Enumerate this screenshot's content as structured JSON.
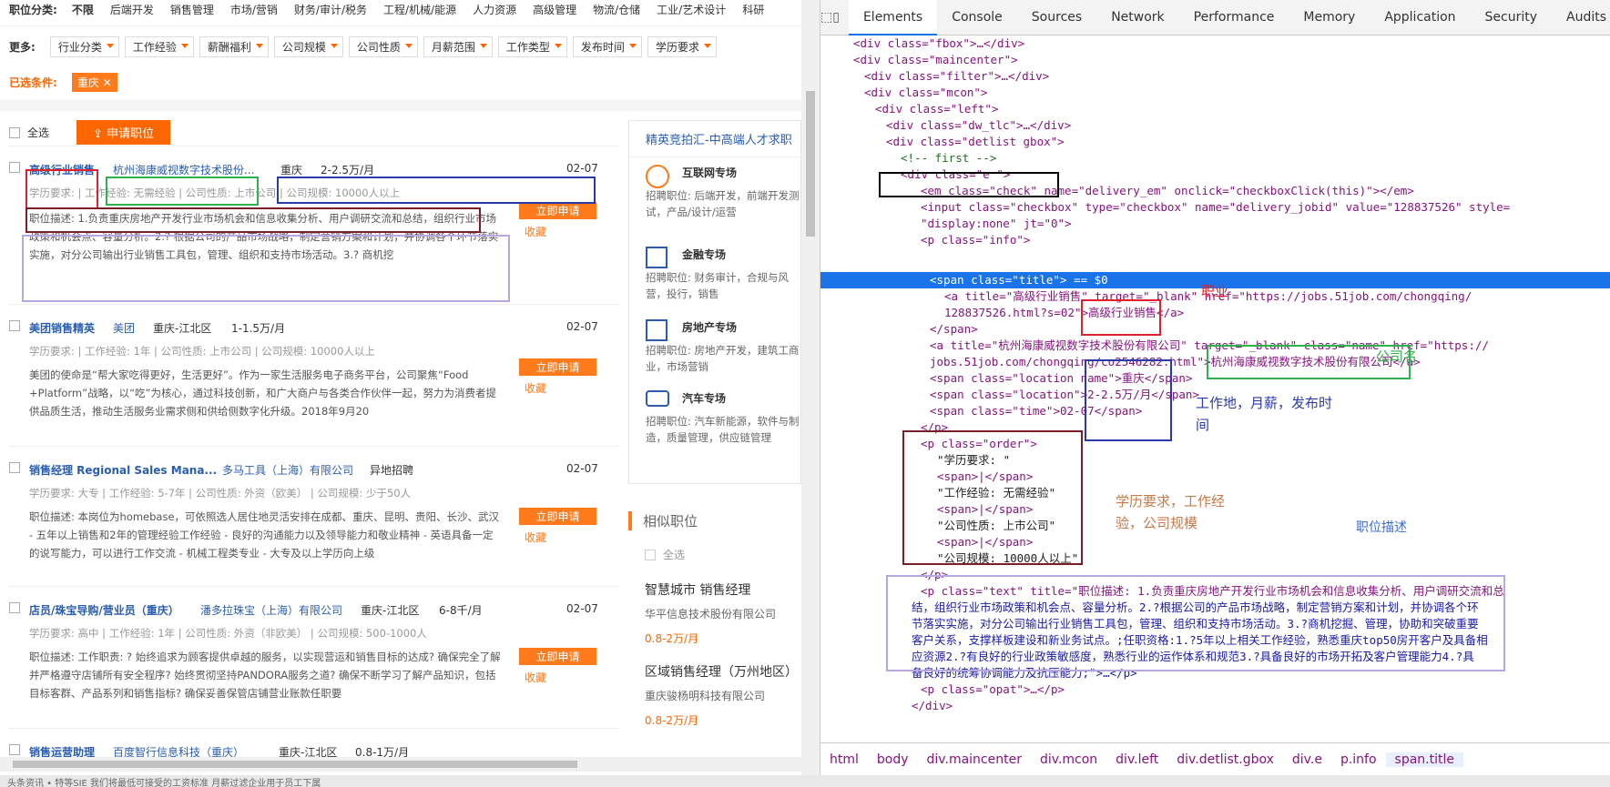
{
  "filters": {
    "row1_label": "职位分类:",
    "row1_opts": [
      "不限",
      "后端开发",
      "销售管理",
      "市场/营销",
      "财务/审计/税务",
      "工程/机械/能源",
      "人力资源",
      "高级管理",
      "物流/仓储",
      "工业/艺术设计",
      "科研"
    ],
    "row2_label": "更多:",
    "row2_opts": [
      "行业分类",
      "工作经验",
      "薪酬福利",
      "公司规模",
      "公司性质",
      "月薪范围",
      "工作类型",
      "发布时间",
      "学历要求"
    ],
    "row3_label": "已选条件:",
    "selected_tag": "重庆",
    "selected_tag_close": "✕"
  },
  "toolbar": {
    "select_all": "全选",
    "apply_label": "申请职位",
    "apply_icon": "⇪"
  },
  "jobs": [
    {
      "title": "高级行业销售",
      "company": "杭州海康威视数字技术股份...",
      "location": "重庆",
      "salary": "2-2.5万/月",
      "date": "02-07",
      "meta": "学历要求:  |  工作经验: 无需经验  |  公司性质: 上市公司  |  公司规模: 10000人以上",
      "desc": "职位描述: 1.负责重庆房地产开发行业市场机会和信息收集分析、用户调研交流和总结，组织行业市场政策和机会点、容量分析。2.? 根据公司的产品市场战略，制定营销方案和计划，并协调各个环节落实实施，对分公司输出行业销售工具包，管理、组织和支持市场活动。3.? 商机挖"
    },
    {
      "title": "美团销售精英",
      "company": "美团",
      "location": "重庆-江北区",
      "salary": "1-1.5万/月",
      "date": "02-07",
      "meta": "学历要求:  |  工作经验: 1年  |  公司性质: 上市公司  |  公司规模: 10000人以上",
      "desc": "美团的使命是“帮大家吃得更好，生活更好”。作为一家生活服务电子商务平台，公司聚焦“Food +Platform”战略，以“吃”为核心，通过科技创新，和广大商户与各类合作伙伴一起，努力为消费者提供品质生活，推动生活服务业需求侧和供给侧数字化升级。2018年9月20"
    },
    {
      "title": "销售经理 Regional Sales Mana...",
      "company": "多马工具（上海）有限公司",
      "location": "异地招聘",
      "salary": "",
      "date": "02-07",
      "meta": "学历要求: 大专  |  工作经验: 5-7年  |  公司性质: 外资（欧美）  |  公司规模: 少于50人",
      "desc": "职位描述: 本岗位为homebase，可依照选人居住地灵活安排在成都、重庆、昆明、贵阳、长沙、武汉 - 五年以上销售和2年的管理经验工作经验 - 良好的沟通能力以及领导能力和敬业精神 - 英语具备一定的说写能力，可以进行工作交流 - 机械工程类专业 - 大专及以上学历向上级"
    },
    {
      "title": "店员/珠宝导购/营业员（重庆）",
      "company": "潘多拉珠宝（上海）有限公司",
      "location": "重庆-江北区",
      "salary": "6-8千/月",
      "date": "02-07",
      "meta": "学历要求: 高中  |  工作经验: 1年  |  公司性质: 外资（非欧美）  |  公司规模: 500-1000人",
      "desc": "职位描述: 工作职责: ? 始终追求为顾客提供卓越的服务，以实现营运和销售目标的达成? 确保完全了解并严格遵守店铺所有安全程序? 始终贯彻坚持PANDORA服务之道? 确保不断学习了解产品知识，包括目标客群、产品系列和销售指标? 确保妥善保管店铺营业账款任职要"
    },
    {
      "title": "销售运营助理",
      "company": "百度智行信息科技（重庆）",
      "location": "重庆-江北区",
      "salary": "0.8-1万/月",
      "date": ""
    }
  ],
  "apply_now": "立即申请",
  "fav": "收藏",
  "side": {
    "header": "精英竞拍汇-中高端人才求职",
    "items": [
      {
        "title": "互联网专场",
        "desc": "招聘职位: 后端开发，前端开发测试，产品/设计/运营"
      },
      {
        "title": "金融专场",
        "desc": "招聘职位: 财务审计，合规与风营，投行，销售"
      },
      {
        "title": "房地产专场",
        "desc": "招聘职位: 房地产开发，建筑工商业，市场营销"
      },
      {
        "title": "汽车专场",
        "desc": "招聘职位: 汽车新能源，软件与制造，质量管理，供应链管理"
      }
    ],
    "similar": "相似职位",
    "similar_all": "全选",
    "sim_jobs": [
      {
        "title": "智慧城市 销售经理",
        "company": "华平信息技术股份有限公司",
        "salary": "0.8-2万/月"
      },
      {
        "title": "区域销售经理（万州地区）",
        "company": "重庆骏杨明科技有限公司",
        "salary": "0.8-2万/月"
      }
    ]
  },
  "devtools": {
    "tabs": [
      "Elements",
      "Console",
      "Sources",
      "Network",
      "Performance",
      "Memory",
      "Application",
      "Security",
      "Audits"
    ],
    "lines": [
      "<div class=\"fbox\">…</div>",
      "<div class=\"maincenter\">",
      "<div class=\"filter\">…</div>",
      "<div class=\"mcon\">",
      "<div class=\"left\">",
      "<div class=\"dw_tlc\">…</div>",
      "<div class=\"detlist gbox\">",
      "<!-- first -->",
      "<div class=\"e \">",
      "<em class=\"check\" name=\"delivery_em\" onclick=\"checkboxClick(this)\"></em>",
      "<input class=\"checkbox\" type=\"checkbox\" name=\"delivery_jobid\" value=\"128837526\" style=",
      "\"display:none\" jt=\"0\">",
      "<p class=\"info\">",
      "<span class=\"title\"> == $0",
      "<a title=\"高级行业销售\" target=\"_blank\" href=\"https://jobs.51job.com/chongqing/",
      "128837526.html?s=02\">高级行业销售</a>",
      "</span>",
      "<a title=\"杭州海康威视数字技术股份有限公司\" target=\"_blank\" class=\"name\" href=\"https://",
      "jobs.51job.com/chongqing/co2546282.html\">杭州海康威视数字技术股份有限公司</a>",
      "<span class=\"location name\">重庆</span>",
      "<span class=\"location\">2-2.5万/月</span>",
      "<span class=\"time\">02-07</span>",
      "</p>",
      "<p class=\"order\">",
      "\"学历要求: \"",
      "<span>|</span>",
      "\"工作经验: 无需经验\"",
      "<span>|</span>",
      "\"公司性质: 上市公司\"",
      "<span>|</span>",
      "\"公司规模: 10000人以上\"",
      "</p>",
      "<p class=\"text\" title=\"职位描述: 1.负责重庆房地产开发行业市场机会和信息收集分析、用户调研交流和总",
      "结，组织行业市场政策和机会点、容量分析。2.?根据公司的产品市场战略，制定营销方案和计划，并协调各个环",
      "节落实实施，对分公司输出行业销售工具包，管理、组织和支持市场活动。3.?商机挖掘、管理，协助和突破重要",
      "客户关系，支撑样板建设和新业务试点。;任职资格:1.?5年以上相关工作经验，熟悉重庆top50房开客户及具备相",
      "应资源2.?有良好的行业政策敏感度，熟悉行业的运作体系和规范3.?具备良好的市场开拓及客户管理能力4.?具",
      "备良好的统筹协调能力及抗压能力;\">…</p>",
      "<p class=\"opat\">…</p>",
      "</div>"
    ],
    "crumbs": [
      "html",
      "body",
      "div.maincenter",
      "div.mcon",
      "div.left",
      "div.detlist.gbox",
      "div.e",
      "p.info",
      "span.title"
    ]
  },
  "annotations": {
    "job": "职业",
    "company": "公司名",
    "loc": "工作地，月薪，发布时间",
    "order": "学历要求，工作经验，公司规模",
    "desc": "职位描述"
  },
  "bottom": "头条资讯  •  特等SIE  我们将最低可接受的工资标准  月薪过滤企业用于员工下属"
}
